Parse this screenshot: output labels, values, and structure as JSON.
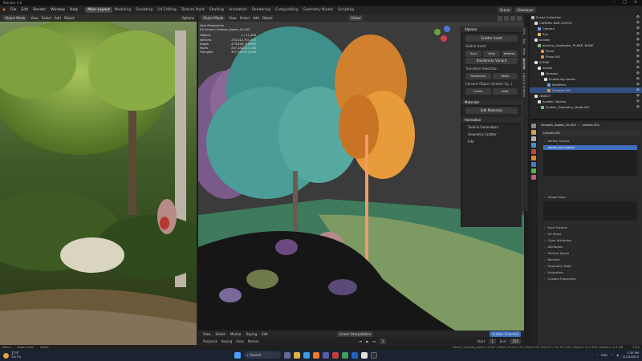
{
  "window": {
    "title": "Blender 3.6",
    "minimize": "–",
    "maximize": "□",
    "close": "✕"
  },
  "menu": {
    "items": [
      "File",
      "Edit",
      "Render",
      "Window",
      "Help"
    ],
    "workspaces": [
      "Main Layout",
      "Modeling",
      "Sculpting",
      "UV Editing",
      "Texture Paint",
      "Shading",
      "Animation",
      "Rendering",
      "Compositing",
      "Geometry Nodes",
      "Scripting"
    ],
    "scene_label": "Scene",
    "view_layer_label": "ViewLayer"
  },
  "left_viewport": {
    "mode": "Object Mode",
    "menus": [
      "View",
      "Select",
      "Add",
      "Object"
    ],
    "options": "Options"
  },
  "viewport": {
    "mode": "Object Mode",
    "menus": [
      "View",
      "Select",
      "Add",
      "Object"
    ],
    "transform": "Global",
    "options": "Options",
    "stats": {
      "heading": "User Perspective",
      "subheading": "(0) Scene | Grasses_Aspen_10.002",
      "rows": [
        {
          "label": "Objects",
          "value": "1 / 11,308"
        },
        {
          "label": "Vertices",
          "value": "253,412,751,592"
        },
        {
          "label": "Edges",
          "value": "479,836,716,660"
        },
        {
          "label": "Faces",
          "value": "207,184,513,168"
        },
        {
          "label": "Triangles",
          "value": "397,359,513,000"
        }
      ]
    }
  },
  "npanel": {
    "title": "Alpinea",
    "items": [
      {
        "kind": "btn",
        "label": "Scatter Asset"
      },
      {
        "kind": "label",
        "label": "Switch Asset"
      },
      {
        "kind": "row",
        "labels": [
          "Sync",
          "Hello",
          "Weather"
        ]
      },
      {
        "kind": "btn",
        "label": "Randomize Variant"
      },
      {
        "kind": "label",
        "label": "Transform Selection"
      },
      {
        "kind": "row",
        "labels": [
          "Randomize",
          "Reset"
        ]
      },
      {
        "kind": "label",
        "label": "Convert Object (Scatter Sy...)"
      },
      {
        "kind": "row",
        "labels": [
          "Linked",
          "Instd"
        ]
      },
      {
        "kind": "head",
        "label": "Materials"
      },
      {
        "kind": "btn",
        "label": "Edit Materials"
      },
      {
        "kind": "head",
        "label": "Animation"
      },
      {
        "kind": "sub",
        "label": "Tools & Generators"
      },
      {
        "kind": "sub",
        "label": "Geometry Scatter"
      },
      {
        "kind": "sub",
        "label": "Info"
      }
    ],
    "tabs": [
      "Item",
      "Tool",
      "View",
      "Alpinea",
      "Lights & Scatters"
    ]
  },
  "timeline": {
    "menus": [
      "Playback",
      "Keying",
      "View",
      "Marker"
    ],
    "mode": "Linear Interpolation",
    "frame": "1",
    "start_label": "Start",
    "start": "1",
    "end_label": "End",
    "end": "250",
    "timeline_menus": [
      "View",
      "Select",
      "Marker",
      "Keying",
      "Edit"
    ],
    "summary": "Scatter Selected"
  },
  "outliner": {
    "rows": [
      {
        "label": "Scene Collection",
        "color": "#bbbbbb",
        "sel": false
      },
      {
        "label": "CAMERA AND LIGHTS",
        "color": "#dddddd",
        "sel": false
      },
      {
        "label": "Camera",
        "color": "#6aa0e0",
        "sel": false
      },
      {
        "label": "Sun",
        "color": "#e0c060",
        "sel": false
      },
      {
        "label": "Scatter",
        "color": "#dddddd",
        "sel": false
      },
      {
        "label": "alpinea_GeoNodes, PLANE, NONE",
        "color": "#80c080",
        "sel": false
      },
      {
        "label": "Plane",
        "color": "#e09040",
        "sel": false
      },
      {
        "label": "Plane.001",
        "color": "#e09040",
        "sel": false
      },
      {
        "label": "SCENE",
        "color": "#dddddd",
        "sel": false
      },
      {
        "label": "Assets",
        "color": "#dddddd",
        "sel": false
      },
      {
        "label": "Grasses",
        "color": "#dddddd",
        "sel": false
      },
      {
        "label": "Scattering Assets",
        "color": "#dddddd",
        "sel": false
      },
      {
        "label": "Modifiers",
        "color": "#6aa0e0",
        "sel": false
      },
      {
        "label": "Grasses.001",
        "color": "#e09040",
        "sel": true
      },
      {
        "label": "OBJECT",
        "color": "#dddddd",
        "sel": false
      },
      {
        "label": "Scatter Objects",
        "color": "#dddddd",
        "sel": false
      },
      {
        "label": "Scatter_Geometry_Node.001",
        "color": "#80c080",
        "sel": false
      }
    ]
  },
  "properties": {
    "object": "Grasses_Aspen_10.002",
    "data_name": "Leaves.001",
    "datablock": "Leaves.001",
    "vertex_groups_label": "Vertex Groups",
    "selected_group": "Aspen_and_leaves",
    "shape_keys_label": "Shape Keys",
    "items": [
      "Face Position",
      "UV Maps",
      "Color Attributes",
      "Attributes",
      "Texture Space",
      "Remesh",
      "Geometry Data",
      "Animation",
      "Custom Properties"
    ]
  },
  "status": {
    "left": [
      "Select",
      "Rotate View",
      "Object"
    ],
    "right": "Scene | Grasses_Aspen_10.002 | Verts 253,412,751 | Faces 207,184,513 | Tris 397,359 | Objects 1/11,308 | Memory 12.4 GiB",
    "version": "3.6.0"
  },
  "taskbar": {
    "temp": "77°F",
    "weather": "Sunny",
    "search": "Search",
    "lang": "ENG",
    "time": "1:35 PM",
    "date": "11/24/2023"
  },
  "colors": {
    "accent": "#3e6fbf",
    "selected_orange": "#e89b3a",
    "teal_tree": "#4fa39a"
  }
}
